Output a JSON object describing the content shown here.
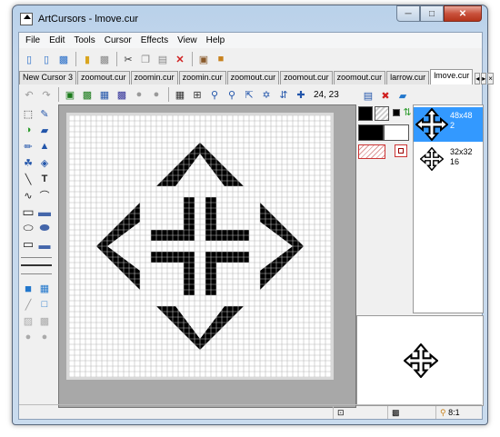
{
  "window": {
    "title": "ArtCursors - lmove.cur"
  },
  "menu": [
    "File",
    "Edit",
    "Tools",
    "Cursor",
    "Effects",
    "View",
    "Help"
  ],
  "tabs": [
    "New Cursor 3",
    "zoomout.cur",
    "zoomin.cur",
    "zoomin.cur",
    "zoomout.cur",
    "zoomout.cur",
    "zoomout.cur",
    "larrow.cur",
    "lmove.cur"
  ],
  "active_tab": 8,
  "toolbar2": {
    "coords": "24, 23"
  },
  "formats": [
    {
      "size": "48x48",
      "bits": "2",
      "selected": true
    },
    {
      "size": "32x32",
      "bits": "16",
      "selected": false
    }
  ],
  "status": {
    "zoom": "8:1"
  },
  "colors": {
    "accent": "#3399ff",
    "close": "#c9523c"
  },
  "icons": {
    "toolbar1": [
      "new-file-icon",
      "open-file-icon",
      "save-icon",
      "open-folder-icon",
      "save-all-icon",
      "cut-icon",
      "copy-icon",
      "paste-icon",
      "delete-icon",
      "library-icon",
      "book-icon"
    ],
    "toolbar2": [
      "undo-icon",
      "redo-icon",
      "mode-icon",
      "image-icon",
      "layers-icon",
      "blend-icon",
      "filter-icon",
      "grid-icon",
      "grid-fine-icon",
      "zoom-in-icon",
      "zoom-out-icon",
      "select-hotspot-icon",
      "move-arrows-icon",
      "flip-icon",
      "hotspot-icon"
    ]
  }
}
